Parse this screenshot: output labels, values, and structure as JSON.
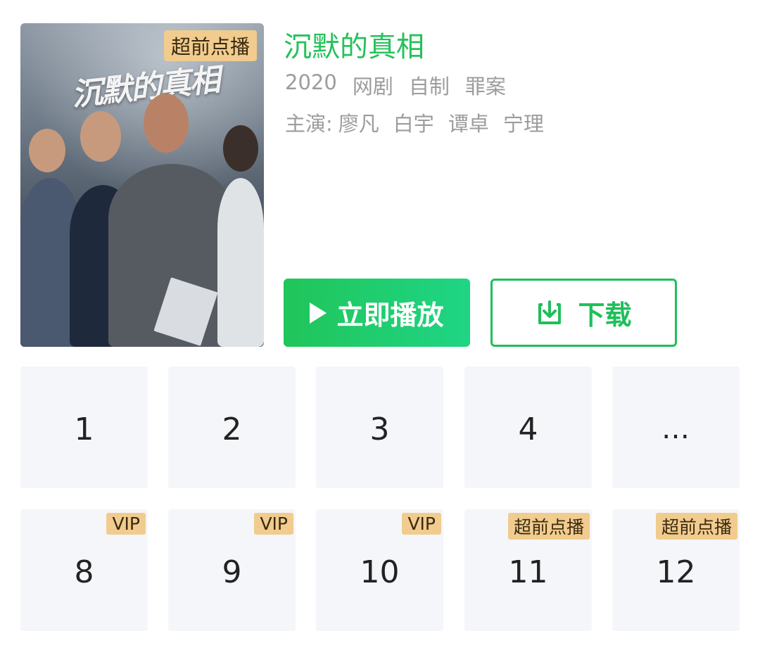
{
  "poster": {
    "badge": "超前点播",
    "title_art": "沉默的真相"
  },
  "show": {
    "title": "沉默的真相",
    "meta": [
      "2020",
      "网剧",
      "自制",
      "罪案"
    ],
    "cast_label": "主演:",
    "cast": [
      "廖凡",
      "白宇",
      "谭卓",
      "宁理"
    ]
  },
  "actions": {
    "play_label": "立即播放",
    "download_label": "下载"
  },
  "episodes": [
    {
      "label": "1",
      "badge": ""
    },
    {
      "label": "2",
      "badge": ""
    },
    {
      "label": "3",
      "badge": ""
    },
    {
      "label": "4",
      "badge": ""
    },
    {
      "label": "…",
      "badge": ""
    },
    {
      "label": "8",
      "badge": "VIP"
    },
    {
      "label": "9",
      "badge": "VIP"
    },
    {
      "label": "10",
      "badge": "VIP"
    },
    {
      "label": "11",
      "badge": "超前点播"
    },
    {
      "label": "12",
      "badge": "超前点播"
    }
  ],
  "colors": {
    "accent_green": "#25c25a",
    "badge_gold": "#f1cc8e",
    "tile_bg": "#f4f6f9"
  }
}
